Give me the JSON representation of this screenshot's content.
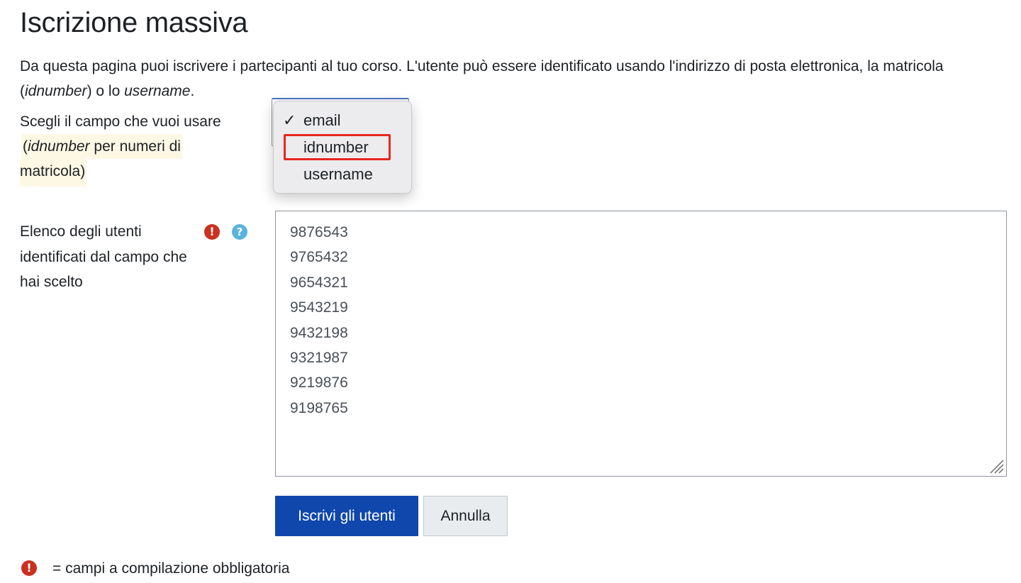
{
  "page": {
    "title": "Iscrizione massiva",
    "intro_part1": "Da questa pagina puoi iscrivere i partecipanti al tuo corso. L'utente può essere identificato usando l'indirizzo di posta elettronica, la matricola (",
    "intro_em1": "idnumber",
    "intro_part2": ") o lo ",
    "intro_em2": "username",
    "intro_part3": "."
  },
  "field_select": {
    "label": "Scegli il campo che vuoi usare",
    "hint_open": "(",
    "hint_em": "idnumber",
    "hint_rest": " per numeri di",
    "hint_line2": "matricola)",
    "options": [
      {
        "label": "email",
        "checked": true
      },
      {
        "label": "idnumber",
        "checked": false
      },
      {
        "label": "username",
        "checked": false
      }
    ],
    "check_glyph": "✓",
    "highlighted_option": "idnumber",
    "highlight_color": "#e8271e"
  },
  "user_list": {
    "label": "Elenco degli utenti identificati dal campo che hai scelto",
    "required_icon": "exclamation-circle-icon",
    "help_icon": "question-circle-icon",
    "lines": [
      "9876543",
      "9765432",
      "9654321",
      "9543219",
      "9432198",
      "9321987",
      "9219876",
      "9198765"
    ]
  },
  "buttons": {
    "submit_label": "Iscrivi gli utenti",
    "cancel_label": "Annulla",
    "primary_color": "#0f47ad"
  },
  "footer": {
    "required_note": "= campi a compilazione obbligatoria"
  }
}
